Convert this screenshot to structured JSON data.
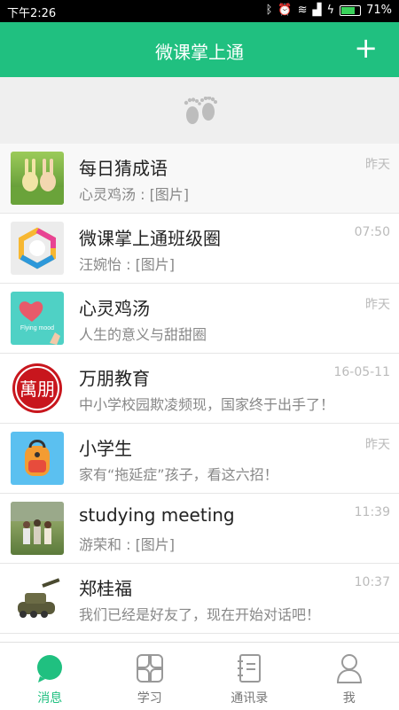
{
  "status_bar": {
    "time": "下午2:26",
    "battery": "71%"
  },
  "header": {
    "title": "微课掌上通",
    "add_icon": "plus-icon"
  },
  "pull_zone": {
    "icon": "footprints-icon"
  },
  "conversations": [
    {
      "name": "每日猜成语",
      "preview": "心灵鸡汤 : [图片]",
      "time": "昨天",
      "avatar": "rabbits-avatar"
    },
    {
      "name": "微课掌上通班级圈",
      "preview": "汪婉怡 : [图片]",
      "time": "07:50",
      "avatar": "hexagon-logo-avatar"
    },
    {
      "name": "心灵鸡汤",
      "preview": "人生的意义与甜甜圈",
      "time": "昨天",
      "avatar": "heart-flying-mood-avatar",
      "avatar_text": "Flying mood"
    },
    {
      "name": "万朋教育",
      "preview": "中小学校园欺凌频现，国家终于出手了！",
      "time": "16-05-11",
      "avatar": "seal-avatar",
      "avatar_text": "萬朋"
    },
    {
      "name": "小学生",
      "preview": "家有“拖延症”孩子，看这六招！",
      "time": "昨天",
      "avatar": "backpack-avatar"
    },
    {
      "name": "studying meeting",
      "preview": "游荣和 : [图片]",
      "time": "11:39",
      "avatar": "group-photo-avatar"
    },
    {
      "name": "郑桂福",
      "preview": "我们已经是好友了，现在开始对话吧！",
      "time": "10:37",
      "avatar": "tank-avatar"
    }
  ],
  "bottom_nav": [
    {
      "label": "消息",
      "icon": "chat-bubble-icon",
      "active": true
    },
    {
      "label": "学习",
      "icon": "grid-petals-icon",
      "active": false
    },
    {
      "label": "通讯录",
      "icon": "address-book-icon",
      "active": false
    },
    {
      "label": "我",
      "icon": "person-icon",
      "active": false
    }
  ],
  "colors": {
    "accent": "#20c080",
    "list_bg": "#ffffff",
    "pull_bg": "#efefef"
  }
}
